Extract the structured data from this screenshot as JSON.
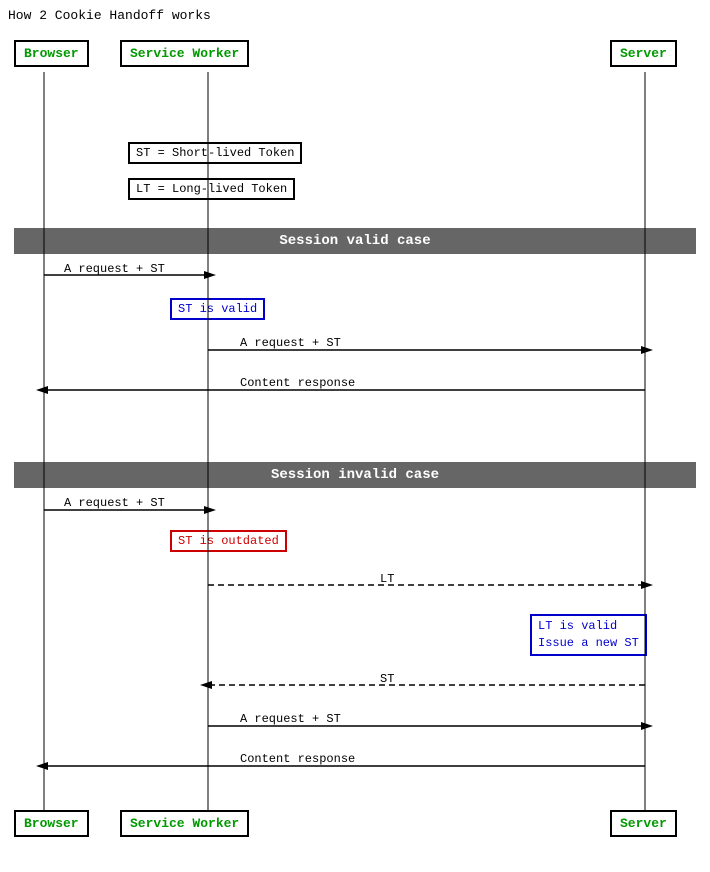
{
  "title": "How 2 Cookie Handoff works",
  "actors": {
    "browser": "Browser",
    "serviceWorker": "Service Worker",
    "server": "Server"
  },
  "sections": {
    "validCase": "Session valid case",
    "invalidCase": "Session invalid case"
  },
  "notes": {
    "st_def": "ST = Short-lived Token",
    "lt_def": "LT = Long-lived Token",
    "st_valid": "ST is valid",
    "st_outdated": "ST is outdated",
    "lt_valid_line1": "LT is valid",
    "lt_valid_line2": "Issue a new ST"
  },
  "arrows": {
    "a_request_st_1": "A request + ST",
    "a_request_st_2": "A request + ST",
    "content_response_1": "Content response",
    "a_request_st_3": "A request + ST",
    "lt_arrow": "LT",
    "st_arrow": "ST",
    "a_request_st_4": "A request + ST",
    "content_response_2": "Content response"
  },
  "colors": {
    "green": "#009900",
    "blue": "#0000cc",
    "red": "#cc0000",
    "sectionBg": "#666666"
  }
}
